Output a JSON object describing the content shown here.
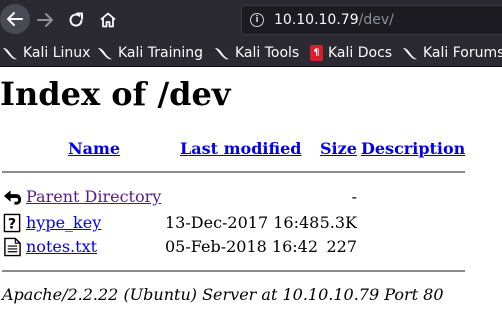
{
  "browser": {
    "url_host": "10.10.10.79",
    "url_path": "/dev/",
    "bookmarks": [
      {
        "label": "Kali Linux",
        "icon": "kali-dragon-icon"
      },
      {
        "label": "Kali Training",
        "icon": "kali-dragon-icon"
      },
      {
        "label": "Kali Tools",
        "icon": "kali-dragon-icon"
      },
      {
        "label": "Kali Docs",
        "icon": "kali-docs-icon"
      },
      {
        "label": "Kali Forums",
        "icon": "kali-dragon-icon"
      }
    ]
  },
  "page": {
    "title": "Index of /dev",
    "columns": {
      "name": "Name",
      "last_modified": "Last modified",
      "size": "Size",
      "description": "Description"
    },
    "rows": [
      {
        "name": "Parent Directory",
        "date": "",
        "size": "-",
        "icon": "back-arrow-icon"
      },
      {
        "name": "hype_key",
        "date": "13-Dec-2017 16:48",
        "size": "5.3K",
        "icon": "unknown-file-icon"
      },
      {
        "name": "notes.txt",
        "date": "05-Feb-2018 16:42",
        "size": "227",
        "icon": "text-file-icon"
      }
    ],
    "footer": "Apache/2.2.22 (Ubuntu) Server at 10.10.10.79 Port 80"
  },
  "colors": {
    "chrome_bg": "#2b2a33",
    "link": "#0000ee",
    "visited_link": "#551a8b"
  }
}
